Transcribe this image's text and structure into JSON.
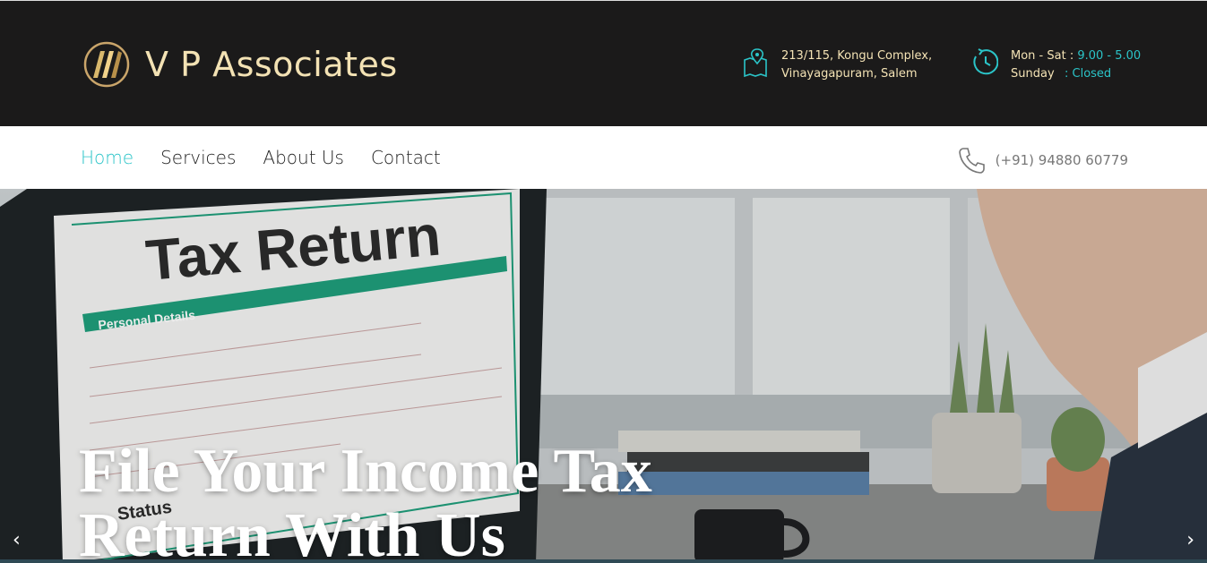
{
  "brand": {
    "name": "V P Associates"
  },
  "contact_info": {
    "address_line1": "213/115, Kongu Complex,",
    "address_line2": "Vinayagapuram, Salem",
    "weekday_label": "Mon - Sat : ",
    "weekday_hours": "9.00 - 5.00",
    "sunday_label": "Sunday",
    "sunday_status": ": Closed",
    "phone": "(+91) 94880 60779"
  },
  "nav": {
    "items": [
      {
        "label": "Home",
        "active": true
      },
      {
        "label": "Services",
        "active": false
      },
      {
        "label": "About Us",
        "active": false
      },
      {
        "label": "Contact",
        "active": false
      }
    ]
  },
  "hero": {
    "title": "File Your Income Tax Return With Us",
    "form_heading": "Tax Return",
    "form_section": "Personal Details",
    "form_status": "Status",
    "prev_arrow": "‹",
    "next_arrow": "›"
  },
  "colors": {
    "accent": "#2bc4c8",
    "header_bg": "#1b1a1a",
    "brand_text": "#f3e2b4"
  },
  "icons": {
    "logo": "brand-logo-icon",
    "address": "map-pin-icon",
    "hours": "clock-icon",
    "phone": "phone-icon"
  }
}
